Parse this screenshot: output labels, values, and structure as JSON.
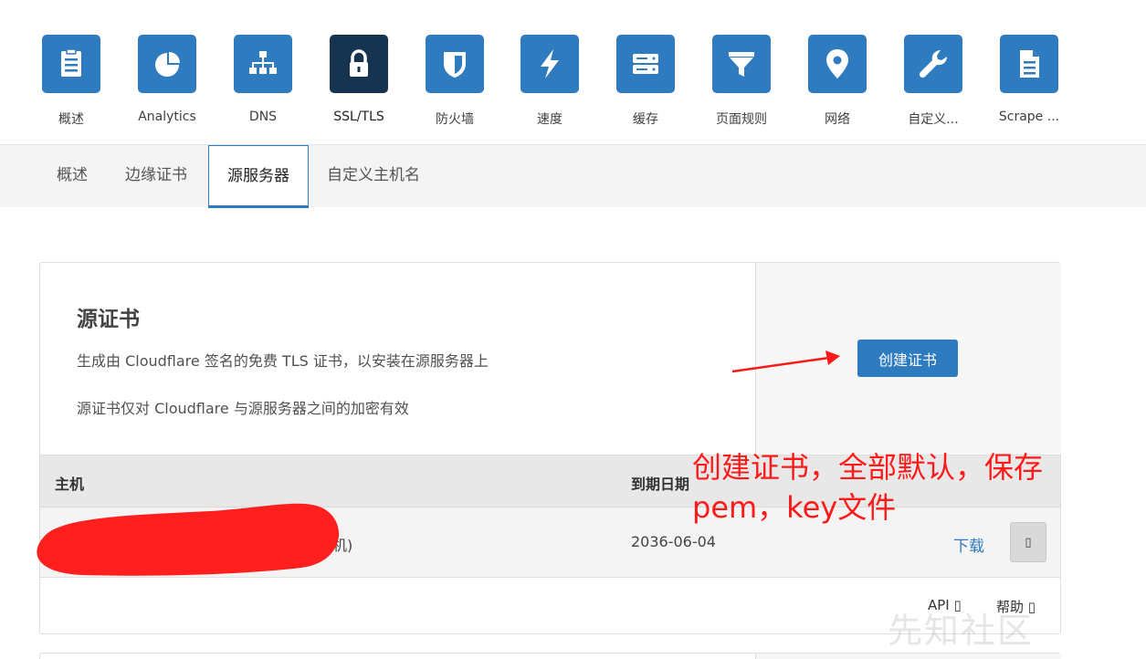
{
  "appnav": {
    "items": [
      {
        "label": "概述",
        "icon": "clipboard-icon"
      },
      {
        "label": "Analytics",
        "icon": "pie-chart-icon"
      },
      {
        "label": "DNS",
        "icon": "network-icon"
      },
      {
        "label": "SSL/TLS",
        "icon": "lock-icon"
      },
      {
        "label": "防火墙",
        "icon": "shield-icon"
      },
      {
        "label": "速度",
        "icon": "lightning-icon"
      },
      {
        "label": "缓存",
        "icon": "server-icon"
      },
      {
        "label": "页面规则",
        "icon": "filter-icon"
      },
      {
        "label": "网络",
        "icon": "location-pin-icon"
      },
      {
        "label": "自定义...",
        "icon": "wrench-icon"
      },
      {
        "label": "Scrape ...",
        "icon": "document-icon"
      }
    ],
    "active_index": 3,
    "colors": {
      "tile": "#2f7bbf",
      "active_tile": "#16344f"
    }
  },
  "subnav": {
    "tabs": [
      "概述",
      "边缘证书",
      "源服务器",
      "自定义主机名"
    ],
    "active_index": 2
  },
  "card": {
    "title": "源证书",
    "desc1": "生成由 Cloudflare 签名的免费 TLS 证书，以安装在源服务器上",
    "desc2": "源证书仅对 Cloudflare 与源服务器之间的加密有效",
    "create_button": "创建证书",
    "table": {
      "headers": {
        "host": "主机",
        "expiry": "到期日期"
      },
      "rows": [
        {
          "host": "机)",
          "expiry": "2036-06-04",
          "download": "下载",
          "action": "▯"
        }
      ]
    },
    "footer": {
      "api": "API ▯",
      "help": "帮助 ▯"
    }
  },
  "annotation": {
    "text": "创建证书，全部默认，保存pem，key文件",
    "color": "#ff1a1a"
  },
  "watermark": "先知社区"
}
